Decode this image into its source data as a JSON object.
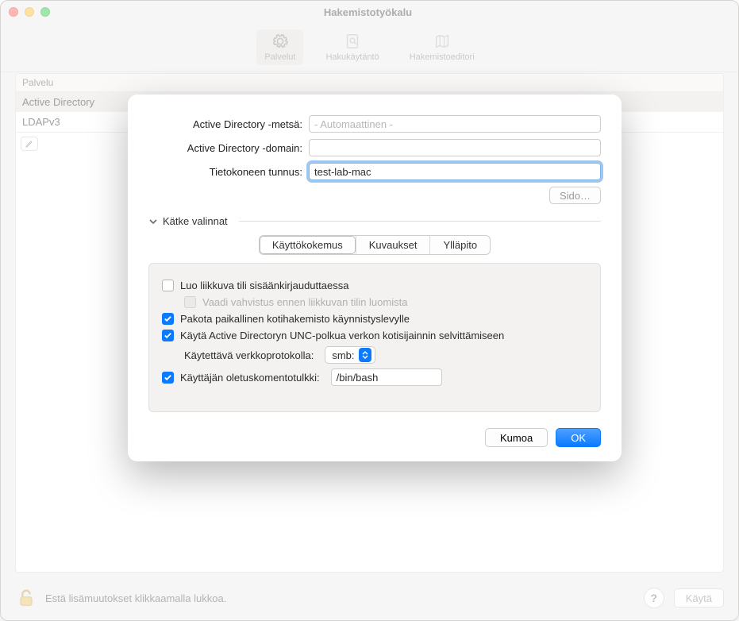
{
  "window": {
    "title": "Hakemistotyökalu"
  },
  "toolbar": {
    "services": "Palvelut",
    "search_policy": "Hakukäytäntö",
    "directory_editor": "Hakemistoeditori"
  },
  "table": {
    "header_service": "Palvelu",
    "rows": [
      "Active Directory",
      "LDAPv3"
    ]
  },
  "bottom": {
    "lock_msg": "Estä lisämuutokset klikkaamalla lukkoa.",
    "help_glyph": "?",
    "apply": "Käytä"
  },
  "sheet": {
    "forest_label": "Active Directory -metsä:",
    "forest_placeholder": "- Automaattinen -",
    "domain_label": "Active Directory -domain:",
    "domain_value": "",
    "computer_label": "Tietokoneen tunnus:",
    "computer_value": "test-lab-mac",
    "bind": "Sido…",
    "disclose": "Kätke valinnat",
    "tabs": {
      "ux": "Käyttökokemus",
      "mappings": "Kuvaukset",
      "admin": "Ylläpito"
    },
    "opts": {
      "mobile": "Luo liikkuva tili sisäänkirjauduttaessa",
      "confirm": "Vaadi vahvistus ennen liikkuvan tilin luomista",
      "force_local": "Pakota paikallinen kotihakemisto käynnistyslevylle",
      "use_unc": "Käytä Active Directoryn UNC-polkua verkon kotisijainnin selvittämiseen",
      "proto_label": "Käytettävä verkkoprotokolla:",
      "proto_value": "smb:",
      "shell_label": "Käyttäjän oletuskomentotulkki:",
      "shell_value": "/bin/bash"
    },
    "cancel": "Kumoa",
    "ok": "OK"
  }
}
